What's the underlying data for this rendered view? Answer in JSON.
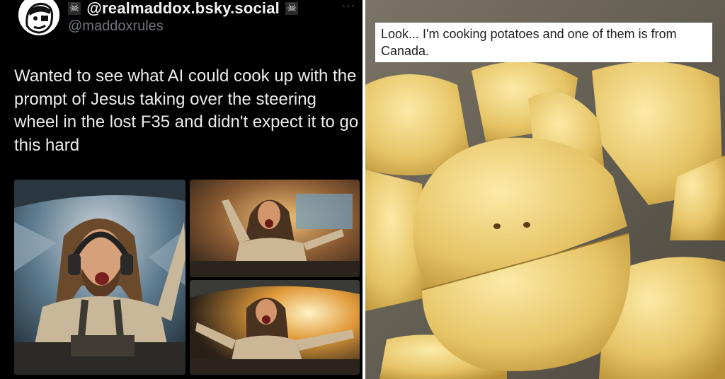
{
  "post": {
    "display_name": "@realmaddox.bsky.social",
    "username": "@maddoxrules",
    "badge_icon": "skull-crossbones-icon",
    "more_icon": "more-dots-icon",
    "text": "Wanted to see what AI could cook up with the prompt of Jesus taking over the steering wheel in the lost F35 and didn't expect it to go this hard",
    "colors": {
      "background": "#000000",
      "text": "#ececec",
      "muted": "#6d757c"
    }
  },
  "meme": {
    "caption": "Look... I'm cooking potatoes and one of them is from Canada."
  }
}
